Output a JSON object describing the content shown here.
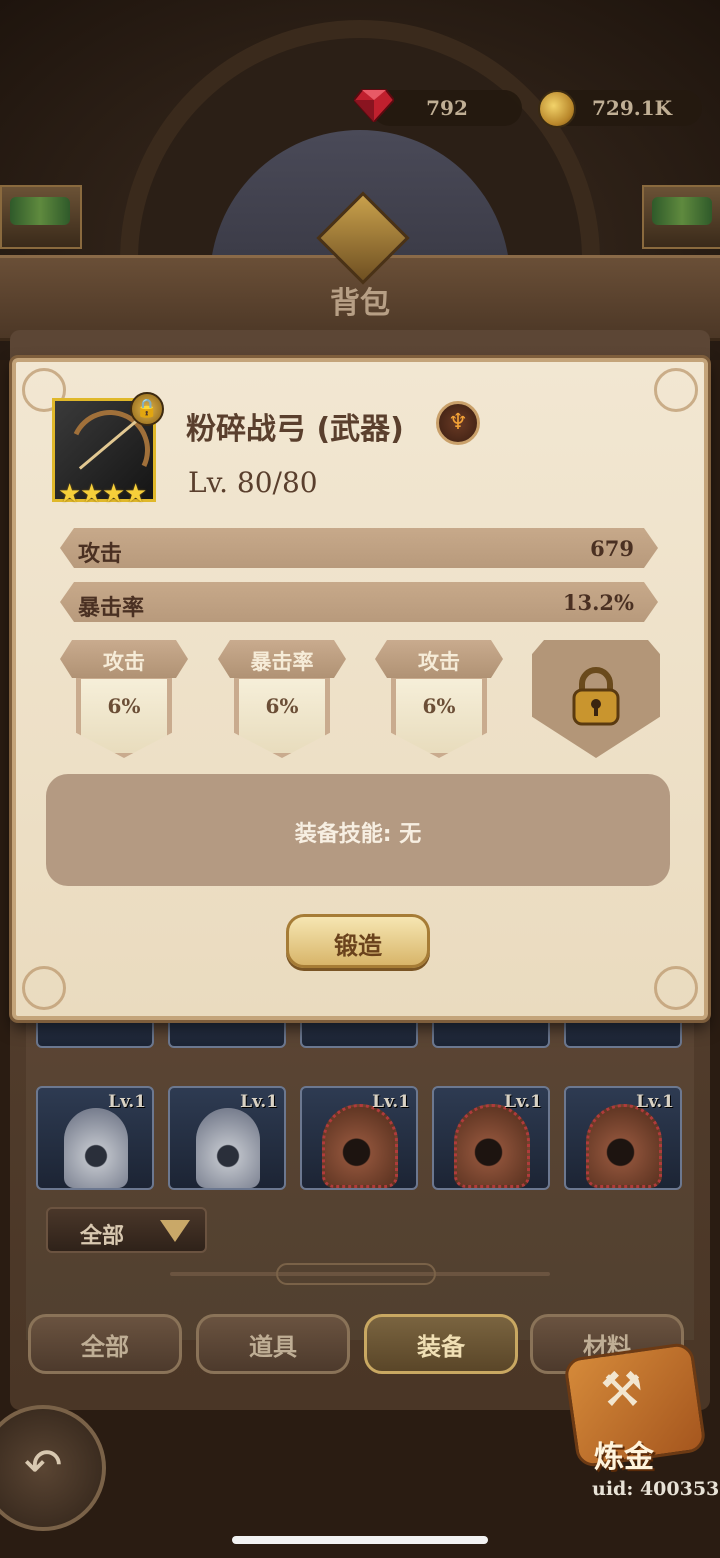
{
  "currency": {
    "gems": "792",
    "gold": "729.1K"
  },
  "header": {
    "title": "背包"
  },
  "item_dialog": {
    "name": "粉碎战弓 (武器)",
    "level": "Lv. 80/80",
    "stars": 4,
    "locked": true,
    "stats": [
      {
        "name": "攻击",
        "value": "679"
      },
      {
        "name": "暴击率",
        "value": "13.2%"
      }
    ],
    "sub_stats": [
      {
        "name": "攻击",
        "value": "6%"
      },
      {
        "name": "暴击率",
        "value": "6%"
      },
      {
        "name": "攻击",
        "value": "6%"
      }
    ],
    "locked_slot": true,
    "skill_text": "装备技能: 无",
    "forge_label": "锻造"
  },
  "inventory": {
    "tiles": [
      {
        "level": "Lv.1",
        "type": "white-hood"
      },
      {
        "level": "Lv.1",
        "type": "white-hood"
      },
      {
        "level": "Lv.1",
        "type": "brown-hood"
      },
      {
        "level": "Lv.1",
        "type": "brown-hood"
      },
      {
        "level": "Lv.1",
        "type": "brown-hood"
      }
    ],
    "filter_label": "全部"
  },
  "tabs": [
    {
      "label": "全部",
      "active": false
    },
    {
      "label": "道具",
      "active": false
    },
    {
      "label": "装备",
      "active": true
    },
    {
      "label": "材料",
      "active": false
    }
  ],
  "alchemy_label": "炼金",
  "uid": "uid: 400353",
  "colors": {
    "parchment": "#f2e7d2",
    "stat_bar": "#c7a98a",
    "accent_gold": "#d8b56a",
    "star": "#f6cf3a"
  }
}
